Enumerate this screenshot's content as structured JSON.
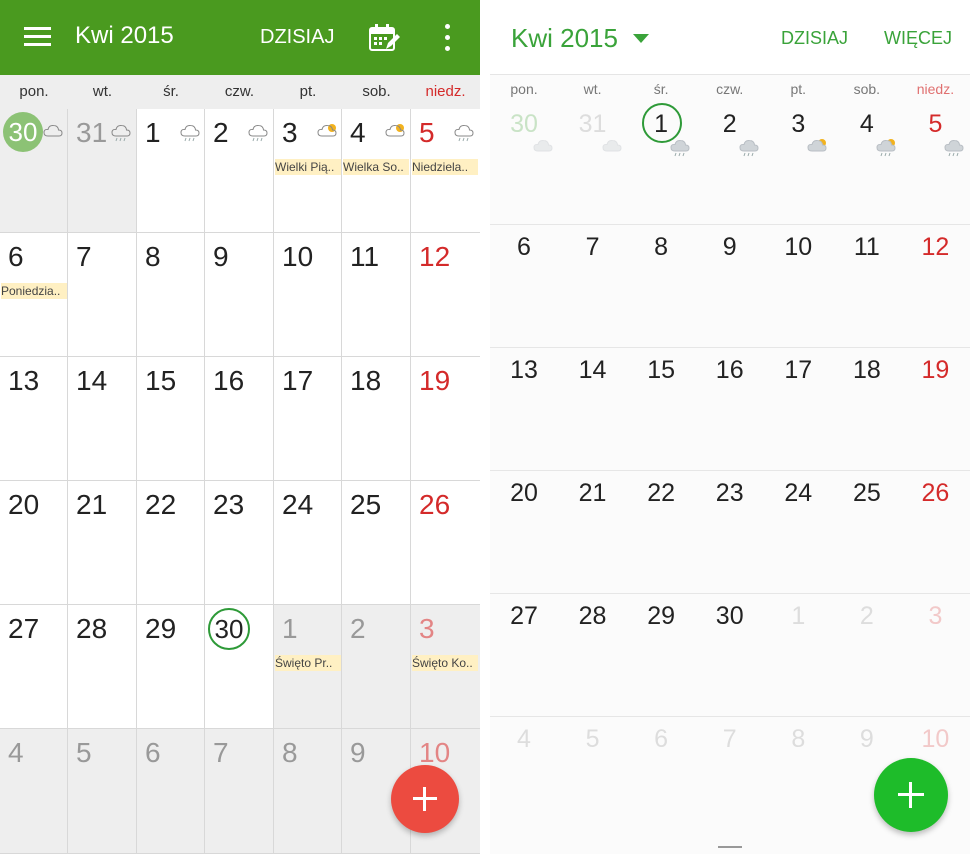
{
  "left": {
    "title": "Kwi 2015",
    "today_label": "DZISIAJ",
    "weekdays": [
      "pon.",
      "wt.",
      "śr.",
      "czw.",
      "pt.",
      "sob.",
      "niedz."
    ],
    "weeks": [
      [
        {
          "d": "30",
          "other": true,
          "today_fill": true,
          "weather": "cloud"
        },
        {
          "d": "31",
          "other": true,
          "weather": "rain"
        },
        {
          "d": "1",
          "weather": "rain"
        },
        {
          "d": "2",
          "weather": "rain"
        },
        {
          "d": "3",
          "weather": "partly-cloudy",
          "event": "Wielki Pią.."
        },
        {
          "d": "4",
          "weather": "partly-cloudy",
          "event": "Wielka So.."
        },
        {
          "d": "5",
          "weather": "rain",
          "event": "Niedziela.."
        }
      ],
      [
        {
          "d": "6",
          "event": "Poniedzia.."
        },
        {
          "d": "7"
        },
        {
          "d": "8"
        },
        {
          "d": "9"
        },
        {
          "d": "10"
        },
        {
          "d": "11"
        },
        {
          "d": "12"
        }
      ],
      [
        {
          "d": "13"
        },
        {
          "d": "14"
        },
        {
          "d": "15"
        },
        {
          "d": "16"
        },
        {
          "d": "17"
        },
        {
          "d": "18"
        },
        {
          "d": "19"
        }
      ],
      [
        {
          "d": "20"
        },
        {
          "d": "21"
        },
        {
          "d": "22"
        },
        {
          "d": "23"
        },
        {
          "d": "24"
        },
        {
          "d": "25"
        },
        {
          "d": "26"
        }
      ],
      [
        {
          "d": "27"
        },
        {
          "d": "28"
        },
        {
          "d": "29"
        },
        {
          "d": "30",
          "today_ring": true
        },
        {
          "d": "1",
          "other": true,
          "event": "Święto Pr.."
        },
        {
          "d": "2",
          "other": true
        },
        {
          "d": "3",
          "other": true,
          "event": "Święto Ko.."
        }
      ],
      [
        {
          "d": "4",
          "other": true
        },
        {
          "d": "5",
          "other": true
        },
        {
          "d": "6",
          "other": true
        },
        {
          "d": "7",
          "other": true
        },
        {
          "d": "8",
          "other": true
        },
        {
          "d": "9",
          "other": true
        },
        {
          "d": "10",
          "other": true
        }
      ]
    ],
    "colors": {
      "appbar": "#4a9a1f",
      "fab": "#ec4b40",
      "sunday": "#d42a2a",
      "event_bg": "#fff0c3"
    }
  },
  "right": {
    "title": "Kwi 2015",
    "today_label": "DZISIAJ",
    "more_label": "WIĘCEJ",
    "weekdays": [
      "pon.",
      "wt.",
      "śr.",
      "czw.",
      "pt.",
      "sob.",
      "niedz."
    ],
    "weeks": [
      [
        {
          "d": "30",
          "other": true,
          "first": true,
          "weather": "cloud"
        },
        {
          "d": "31",
          "other": true,
          "weather": "cloud"
        },
        {
          "d": "1",
          "today_ring": true,
          "weather": "rain"
        },
        {
          "d": "2",
          "weather": "rain"
        },
        {
          "d": "3",
          "weather": "partly-cloudy"
        },
        {
          "d": "4",
          "weather": "partly-cloudy-rain"
        },
        {
          "d": "5",
          "weather": "rain"
        }
      ],
      [
        {
          "d": "6"
        },
        {
          "d": "7"
        },
        {
          "d": "8"
        },
        {
          "d": "9"
        },
        {
          "d": "10"
        },
        {
          "d": "11"
        },
        {
          "d": "12"
        }
      ],
      [
        {
          "d": "13"
        },
        {
          "d": "14"
        },
        {
          "d": "15"
        },
        {
          "d": "16"
        },
        {
          "d": "17"
        },
        {
          "d": "18"
        },
        {
          "d": "19"
        }
      ],
      [
        {
          "d": "20"
        },
        {
          "d": "21"
        },
        {
          "d": "22"
        },
        {
          "d": "23"
        },
        {
          "d": "24"
        },
        {
          "d": "25"
        },
        {
          "d": "26"
        }
      ],
      [
        {
          "d": "27"
        },
        {
          "d": "28"
        },
        {
          "d": "29"
        },
        {
          "d": "30"
        },
        {
          "d": "1",
          "other": true
        },
        {
          "d": "2",
          "other": true
        },
        {
          "d": "3",
          "other": true
        }
      ],
      [
        {
          "d": "4",
          "other": true
        },
        {
          "d": "5",
          "other": true
        },
        {
          "d": "6",
          "other": true
        },
        {
          "d": "7",
          "other": true
        },
        {
          "d": "8",
          "other": true
        },
        {
          "d": "9",
          "other": true
        },
        {
          "d": "10",
          "other": true
        }
      ]
    ],
    "colors": {
      "accent": "#3aa33a",
      "fab": "#1ebc2a",
      "sunday": "#d42a2a"
    }
  }
}
